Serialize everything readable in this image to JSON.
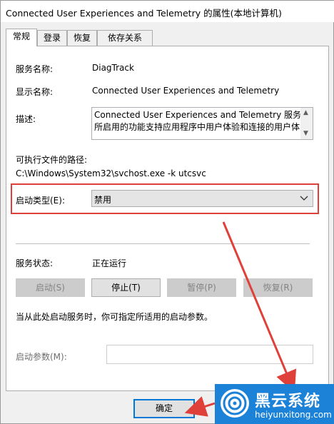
{
  "window": {
    "title": "Connected User Experiences and Telemetry 的属性(本地计算机)"
  },
  "tabs": [
    {
      "label": "常规",
      "active": true
    },
    {
      "label": "登录",
      "active": false
    },
    {
      "label": "恢复",
      "active": false
    },
    {
      "label": "依存关系",
      "active": false
    }
  ],
  "general": {
    "service_name_label": "服务名称:",
    "service_name_value": "DiagTrack",
    "display_name_label": "显示名称:",
    "display_name_value": "Connected User Experiences and Telemetry",
    "description_label": "描述:",
    "description_line1": "Connected User Experiences and Telemetry 服务",
    "description_line2": "所启用的功能支持应用程序中用户体验和连接的用户体",
    "exe_path_label": "可执行文件的路径:",
    "exe_path_value": "C:\\Windows\\System32\\svchost.exe -k utcsvc",
    "startup_type_label": "启动类型(E):",
    "startup_type_value": "禁用",
    "service_status_label": "服务状态:",
    "service_status_value": "正在运行",
    "buttons": {
      "start": "启动(S)",
      "stop": "停止(T)",
      "pause": "暂停(P)",
      "resume": "恢复(R)"
    },
    "hint_text": "当从此处启动服务时，你可指定所适用的启动参数。",
    "start_params_label": "启动参数(M):",
    "start_params_value": ""
  },
  "footer": {
    "ok_label": "确定"
  },
  "watermark": {
    "cn": "黑云系统",
    "en": "heiyunxitong.com"
  },
  "colors": {
    "highlight": "#e0403a",
    "brand": "#1b82d8",
    "focus": "#0078d7"
  }
}
